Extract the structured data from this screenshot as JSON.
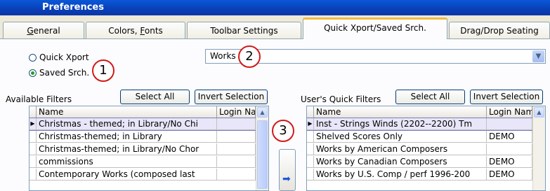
{
  "window": {
    "title": "Preferences"
  },
  "tabs": [
    {
      "label": "General",
      "mnemonic": "G",
      "rest": "eneral"
    },
    {
      "label": "Colors, Fonts",
      "pre": "Colors, ",
      "mnemonic": "F",
      "rest": "onts"
    },
    {
      "label": "Toolbar Settings"
    },
    {
      "label": "Quick Xport/Saved Srch.",
      "active": true
    },
    {
      "label": "Drag/Drop Seating"
    }
  ],
  "mode": {
    "quick_xport_label": "Quick Xport",
    "saved_srch_label": "Saved Srch.",
    "selected": "Saved Srch."
  },
  "search_combo": {
    "value": "Works"
  },
  "callouts": [
    "1",
    "2",
    "3"
  ],
  "available": {
    "title": "Available Filters",
    "select_all": "Select All",
    "invert_selection": "Invert Selection",
    "columns": [
      "Name",
      "Login Name"
    ],
    "rows": [
      {
        "name": "Christmas - themed; in Library/No Chi",
        "login": "",
        "selected": true
      },
      {
        "name": "Christmas-themed; in Library",
        "login": ""
      },
      {
        "name": "Christmas-themed; in Library/No Chor",
        "login": ""
      },
      {
        "name": "commissions",
        "login": ""
      },
      {
        "name": "Contemporary Works (composed last",
        "login": ""
      }
    ]
  },
  "user_filters": {
    "title": "User's Quick Filters",
    "select_all": "Select All",
    "invert_selection": "Invert Selection",
    "columns": [
      "Name",
      "Login Name"
    ],
    "rows": [
      {
        "name": "Inst - Strings Winds (2202--2200) Tm",
        "login": "",
        "selected": true
      },
      {
        "name": "Shelved Scores Only",
        "login": "DEMO"
      },
      {
        "name": "Works by American Composers",
        "login": ""
      },
      {
        "name": "Works by Canadian Composers",
        "login": "DEMO"
      },
      {
        "name": "Works by U.S. Comp / perf 1996-200",
        "login": "DEMO"
      }
    ]
  },
  "icons": {
    "transfer": "arrow-right-icon",
    "combo": "chevron-down-icon",
    "scroll_up": "triangle-up-icon"
  }
}
